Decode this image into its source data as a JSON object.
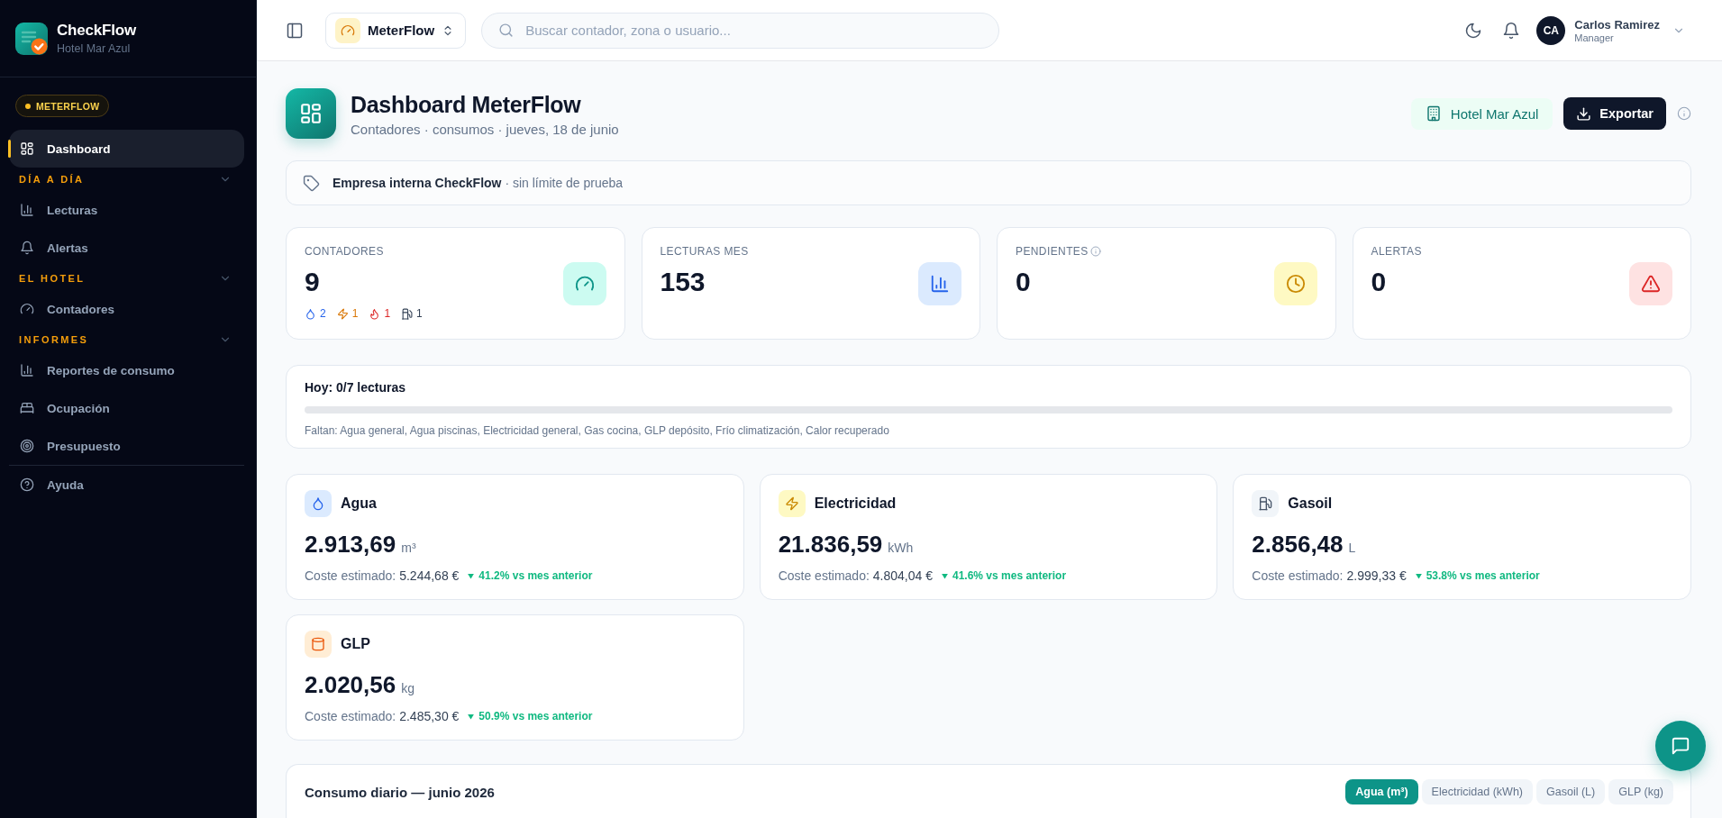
{
  "sidebar": {
    "brand": {
      "name": "CheckFlow",
      "subtitle": "Hotel Mar Azul"
    },
    "badge": "METERFLOW",
    "items": [
      {
        "label": "Dashboard",
        "selected": true
      }
    ],
    "sections": [
      {
        "title": "DÍA A DÍA",
        "expanded": true,
        "items": [
          {
            "label": "Lecturas",
            "selected": false
          },
          {
            "label": "Alertas",
            "selected": false
          }
        ]
      },
      {
        "title": "EL HOTEL",
        "expanded": true,
        "items": [
          {
            "label": "Contadores",
            "selected": false
          }
        ]
      },
      {
        "title": "INFORMES",
        "expanded": true,
        "items": [
          {
            "label": "Reportes de consumo",
            "selected": false
          },
          {
            "label": "Ocupación",
            "selected": false
          },
          {
            "label": "Presupuesto",
            "selected": false
          }
        ]
      }
    ],
    "footer_items": [
      {
        "label": "Ayuda",
        "selected": false
      }
    ]
  },
  "top_bar": {
    "app_switcher": "MeterFlow",
    "search": {
      "placeholder": "Buscar contador, zona o usuario..."
    },
    "user": {
      "initials": "CA",
      "name": "Carlos Ramirez",
      "role": "Manager"
    }
  },
  "page_header": {
    "title": "Dashboard MeterFlow",
    "subtitle": "Contadores · consumos · jueves, 18 de junio",
    "property": "Hotel Mar Azul",
    "export_button": "Exportar"
  },
  "notice": "**Empresa interna CheckFlow** · sin límite de prueba",
  "stats": [
    {
      "label": "CONTADORES",
      "value": "9",
      "info": false,
      "breakdown": [
        {
          "count": "2"
        },
        {
          "count": "1"
        },
        {
          "count": "1"
        },
        {
          "count": "1"
        }
      ]
    },
    {
      "label": "LECTURAS MES",
      "value": "153",
      "info": false
    },
    {
      "label": "PENDIENTES",
      "value": "0",
      "info": true
    },
    {
      "label": "ALERTAS",
      "value": "0",
      "info": false
    }
  ],
  "progress": {
    "title": "Hoy: 0/7 lecturas",
    "level": 0,
    "missing": "Faltan: Agua general, Agua piscinas, Electricidad general, Gas cocina, GLP depósito, Frío climatización, Calor recuperado"
  },
  "consumption": [
    {
      "name": "Agua",
      "value": "2.913,69",
      "unit": "m³",
      "cost_label": "Coste estimado:",
      "cost": "5.244,68 €",
      "trend_down": true,
      "change": "41.2% vs mes anterior"
    },
    {
      "name": "Electricidad",
      "value": "21.836,59",
      "unit": "kWh",
      "cost_label": "Coste estimado:",
      "cost": "4.804,04 €",
      "trend_down": true,
      "change": "41.6% vs mes anterior"
    },
    {
      "name": "Gasoil",
      "value": "2.856,48",
      "unit": "L",
      "cost_label": "Coste estimado:",
      "cost": "2.999,33 €",
      "trend_down": true,
      "change": "53.8% vs mes anterior"
    },
    {
      "name": "GLP",
      "value": "2.020,56",
      "unit": "kg",
      "cost_label": "Coste estimado:",
      "cost": "2.485,30 €",
      "trend_down": true,
      "change": "50.9% vs mes anterior"
    }
  ],
  "chart": {
    "title": "Consumo diario — junio 2026",
    "tabs": [
      {
        "label": "Agua (m³)",
        "selected": true
      },
      {
        "label": "Electricidad (kWh)",
        "selected": false
      },
      {
        "label": "Gasoil (L)",
        "selected": false
      },
      {
        "label": "GLP (kg)",
        "selected": false
      }
    ]
  }
}
